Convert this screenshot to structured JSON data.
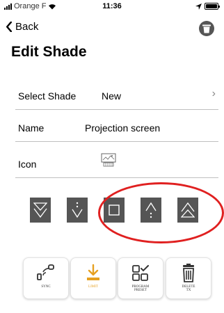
{
  "status_bar": {
    "carrier": "Orange F",
    "time": "11:36"
  },
  "nav": {
    "back_label": "Back",
    "trash_icon": "trash-icon"
  },
  "page_title": "Edit Shade",
  "rows": {
    "select_shade": {
      "label": "Select Shade",
      "value": "New"
    },
    "name": {
      "label": "Name",
      "value": "Projection screen"
    },
    "icon": {
      "label": "Icon"
    }
  },
  "controls": [
    "double-down-arrow-icon",
    "step-down-arrow-icon",
    "stop-square-icon",
    "step-up-arrow-icon",
    "double-up-arrow-icon"
  ],
  "functions": [
    {
      "icon": "sync-icon",
      "label": "SYNC",
      "color": "#333333"
    },
    {
      "icon": "limit-download-icon",
      "label": "LIMIT",
      "color": "#e6a020"
    },
    {
      "icon": "program-preset-icon",
      "label": "PROGRAM\nPRESET",
      "color": "#333333"
    },
    {
      "icon": "delete-tx-icon",
      "label": "DELETE\nTX",
      "color": "#333333"
    }
  ],
  "colors": {
    "control_bg": "#555555",
    "annotation": "#e02020",
    "limit_orange": "#e6a020"
  }
}
